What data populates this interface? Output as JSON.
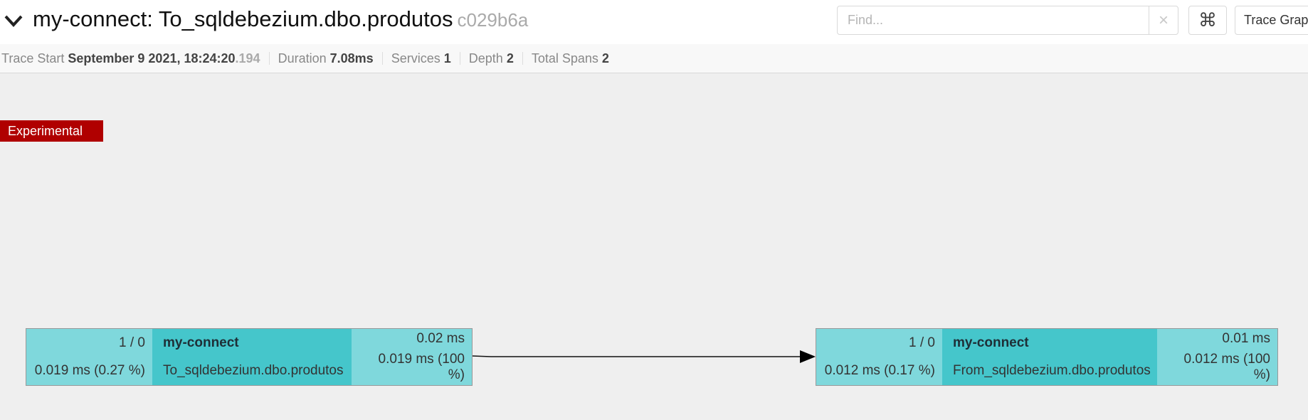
{
  "header": {
    "title": "my-connect: To_sqldebezium.dbo.produtos",
    "trace_id": "c029b6a",
    "search_placeholder": "Find...",
    "search_clear": "×",
    "cmd_symbol": "⌘",
    "view_mode": "Trace Grap"
  },
  "meta": {
    "trace_start_label": "Trace Start",
    "trace_start_value": "September 9 2021, 18:24:20",
    "trace_start_ms": ".194",
    "duration_label": "Duration",
    "duration_value": "7.08ms",
    "services_label": "Services",
    "services_value": "1",
    "depth_label": "Depth",
    "depth_value": "2",
    "total_spans_label": "Total Spans",
    "total_spans_value": "2"
  },
  "badge": "Experimental",
  "nodes": [
    {
      "count": "1 / 0",
      "self_time": "0.019 ms (0.27 %)",
      "service": "my-connect",
      "operation": "To_sqldebezium.dbo.produtos",
      "total_time": "0.02 ms",
      "self_pct": "0.019 ms (100 %)"
    },
    {
      "count": "1 / 0",
      "self_time": "0.012 ms (0.17 %)",
      "service": "my-connect",
      "operation": "From_sqldebezium.dbo.produtos",
      "total_time": "0.01 ms",
      "self_pct": "0.012 ms (100 %)"
    }
  ],
  "colors": {
    "node_light": "#7fd8dc",
    "node_mid": "#45c6cb",
    "badge": "#b00000"
  },
  "icons": {
    "collapse": "chevron-down-icon",
    "clear": "close-icon",
    "command": "command-icon",
    "edge": "arrow-icon"
  }
}
